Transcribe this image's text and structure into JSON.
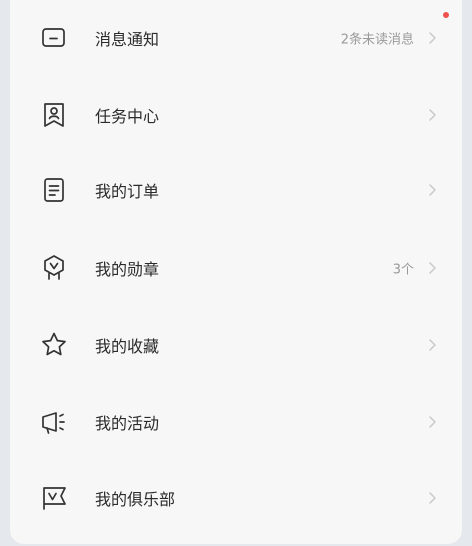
{
  "notification_dot_color": "#f0514c",
  "menu": {
    "items": [
      {
        "label": "消息通知",
        "value": "2条未读消息",
        "icon": "message-icon"
      },
      {
        "label": "任务中心",
        "value": "",
        "icon": "task-badge-icon"
      },
      {
        "label": "我的订单",
        "value": "",
        "icon": "order-document-icon"
      },
      {
        "label": "我的勋章",
        "value": "3个",
        "icon": "medal-icon"
      },
      {
        "label": "我的收藏",
        "value": "",
        "icon": "star-icon"
      },
      {
        "label": "我的活动",
        "value": "",
        "icon": "megaphone-icon"
      },
      {
        "label": "我的俱乐部",
        "value": "",
        "icon": "club-flag-icon"
      }
    ]
  }
}
